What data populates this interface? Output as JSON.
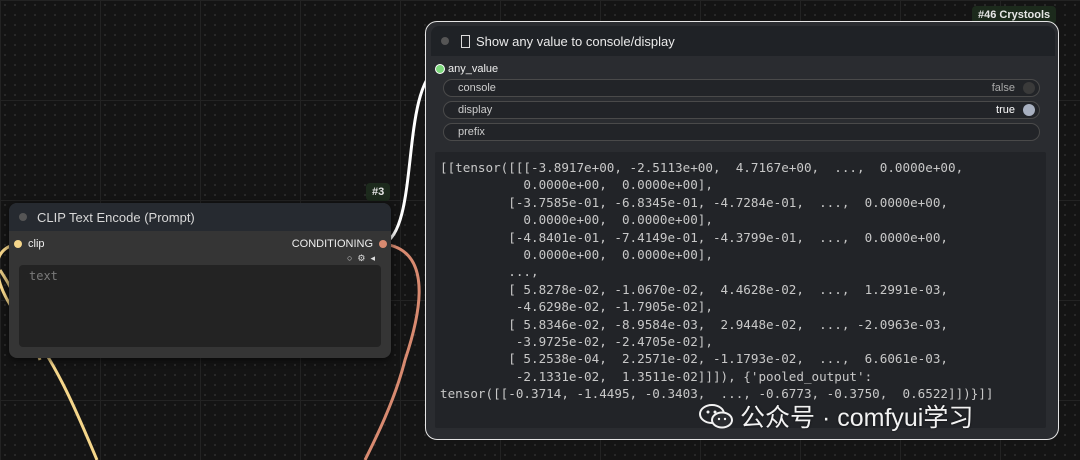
{
  "clip_node": {
    "badge": "#3",
    "title": "CLIP Text Encode (Prompt)",
    "input_label": "clip",
    "output_label": "CONDITIONING",
    "text_placeholder": "text"
  },
  "show_node": {
    "badge": "#46 Crystools",
    "title": "Show any value to console/display",
    "input_label": "any_value",
    "widgets": [
      {
        "label": "console",
        "value": "false"
      },
      {
        "label": "display",
        "value": "true"
      },
      {
        "label": "prefix",
        "value": ""
      }
    ],
    "output_text": "[[tensor([[[-3.8917e+00, -2.5113e+00,  4.7167e+00,  ...,  0.0000e+00,\n           0.0000e+00,  0.0000e+00],\n         [-3.7585e-01, -6.8345e-01, -4.7284e-01,  ...,  0.0000e+00,\n           0.0000e+00,  0.0000e+00],\n         [-4.8401e-01, -7.4149e-01, -4.3799e-01,  ...,  0.0000e+00,\n           0.0000e+00,  0.0000e+00],\n         ...,\n         [ 5.8278e-02, -1.0670e-02,  4.4628e-02,  ...,  1.2991e-03,\n          -4.6298e-02, -1.7905e-02],\n         [ 5.8346e-02, -8.9584e-03,  2.9448e-02,  ..., -2.0963e-03,\n          -3.9725e-02, -2.4705e-02],\n         [ 5.2538e-04,  2.2571e-02, -1.1793e-02,  ...,  6.6061e-03,\n          -2.1331e-02,  1.3511e-02]]]), {'pooled_output':\ntensor([[-0.3714, -1.4495, -0.3403,  ..., -0.6773, -0.3750,  0.6522]])}]]"
  },
  "watermark": {
    "text": "公众号 · comfyui学习"
  },
  "colors": {
    "clip_link": "#f5d68a",
    "conditioning_link": "#d88a70",
    "any_link": "#ffffff",
    "any_socket": "#7cd87c"
  }
}
